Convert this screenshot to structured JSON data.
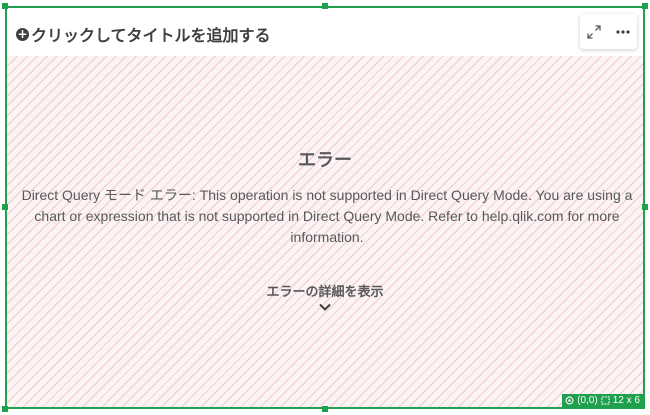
{
  "header": {
    "add_title_label": "クリックしてタイトルを追加する"
  },
  "toolbar": {
    "icons": [
      "expand-icon",
      "more-icon"
    ]
  },
  "error": {
    "title": "エラー",
    "message": "Direct Query モード エラー: This operation is not supported in Direct Query Mode. You are using a chart or expression that is not supported in Direct Query Mode. Refer to help.qlik.com for more information.",
    "details_label": "エラーの詳細を表示"
  },
  "status": {
    "position": "(0,0)",
    "size": "12 x 6"
  },
  "colors": {
    "selection": "#1fa04c",
    "error_bg": "#fbf3f4",
    "stripe": "#f0c8cd",
    "text": "#595959"
  }
}
